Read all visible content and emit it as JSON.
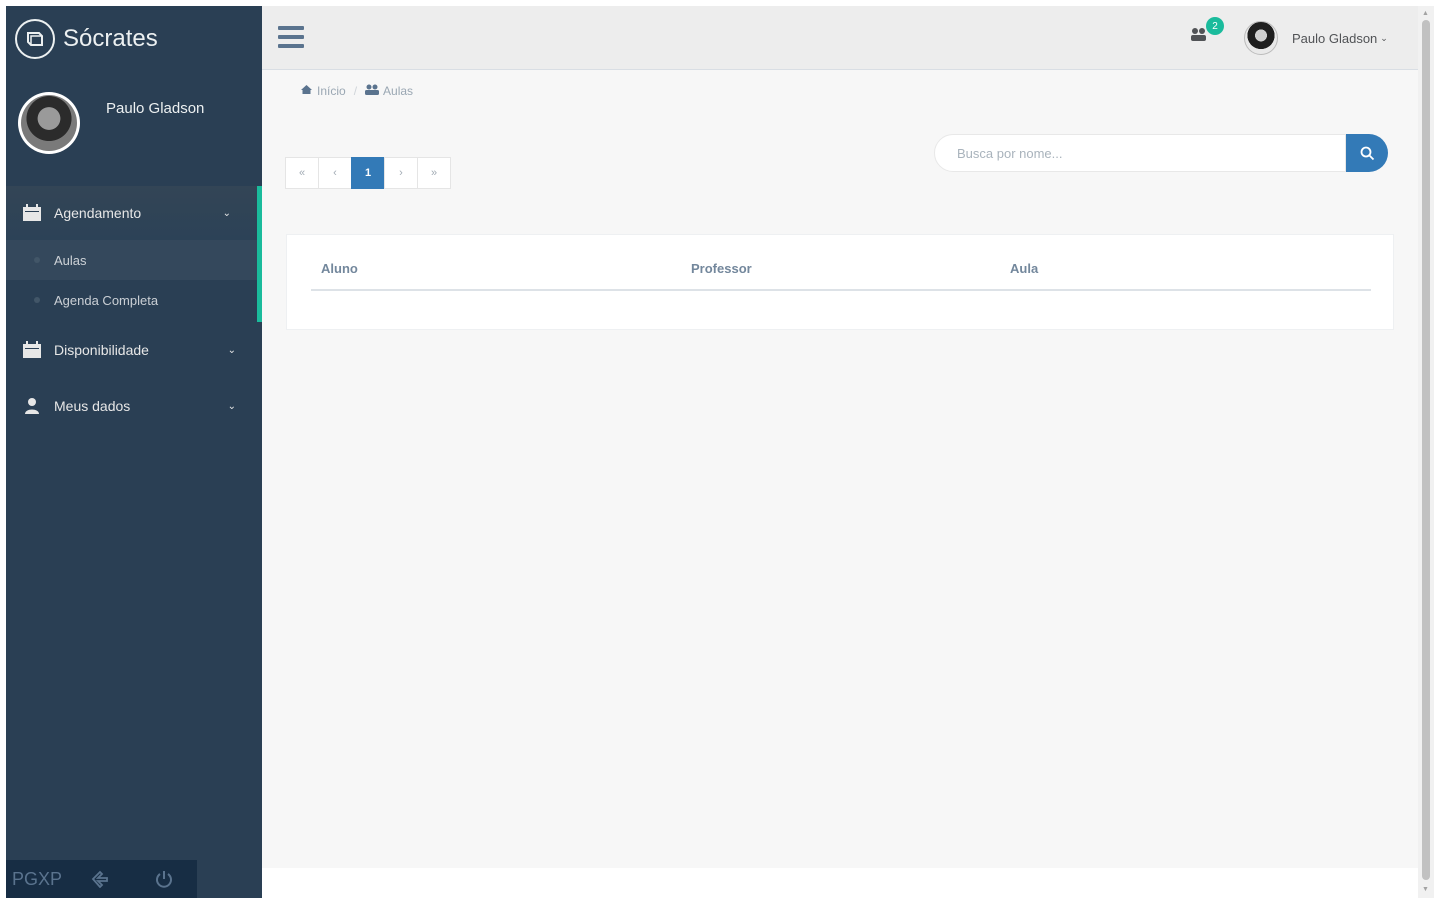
{
  "app": {
    "title": "Sócrates",
    "logo_icon": "book-icon"
  },
  "profile": {
    "name": "Paulo Gladson"
  },
  "sidebar": {
    "menu": [
      {
        "label": "Agendamento",
        "icon": "calendar-icon",
        "expanded": true,
        "children": [
          {
            "label": "Aulas",
            "current": true
          },
          {
            "label": "Agenda Completa"
          }
        ]
      },
      {
        "label": "Disponibilidade",
        "icon": "calendar-icon"
      },
      {
        "label": "Meus dados",
        "icon": "user-icon"
      }
    ],
    "footer": {
      "brand": "PGXP",
      "icons": [
        "settings-hand-icon",
        "power-icon"
      ]
    }
  },
  "topnav": {
    "notifications_count": "2",
    "user_name": "Paulo Gladson"
  },
  "breadcrumb": {
    "home": "Início",
    "current": "Aulas"
  },
  "pagination": {
    "first": "«",
    "prev": "‹",
    "current": "1",
    "next": "›",
    "last": "»"
  },
  "search": {
    "placeholder": "Busca por nome..."
  },
  "table": {
    "columns": [
      "Aluno",
      "Professor",
      "Aula"
    ],
    "rows": []
  },
  "colors": {
    "sidebar": "#2a3f54",
    "accent": "#1abb9c",
    "primary": "#337ab7"
  }
}
